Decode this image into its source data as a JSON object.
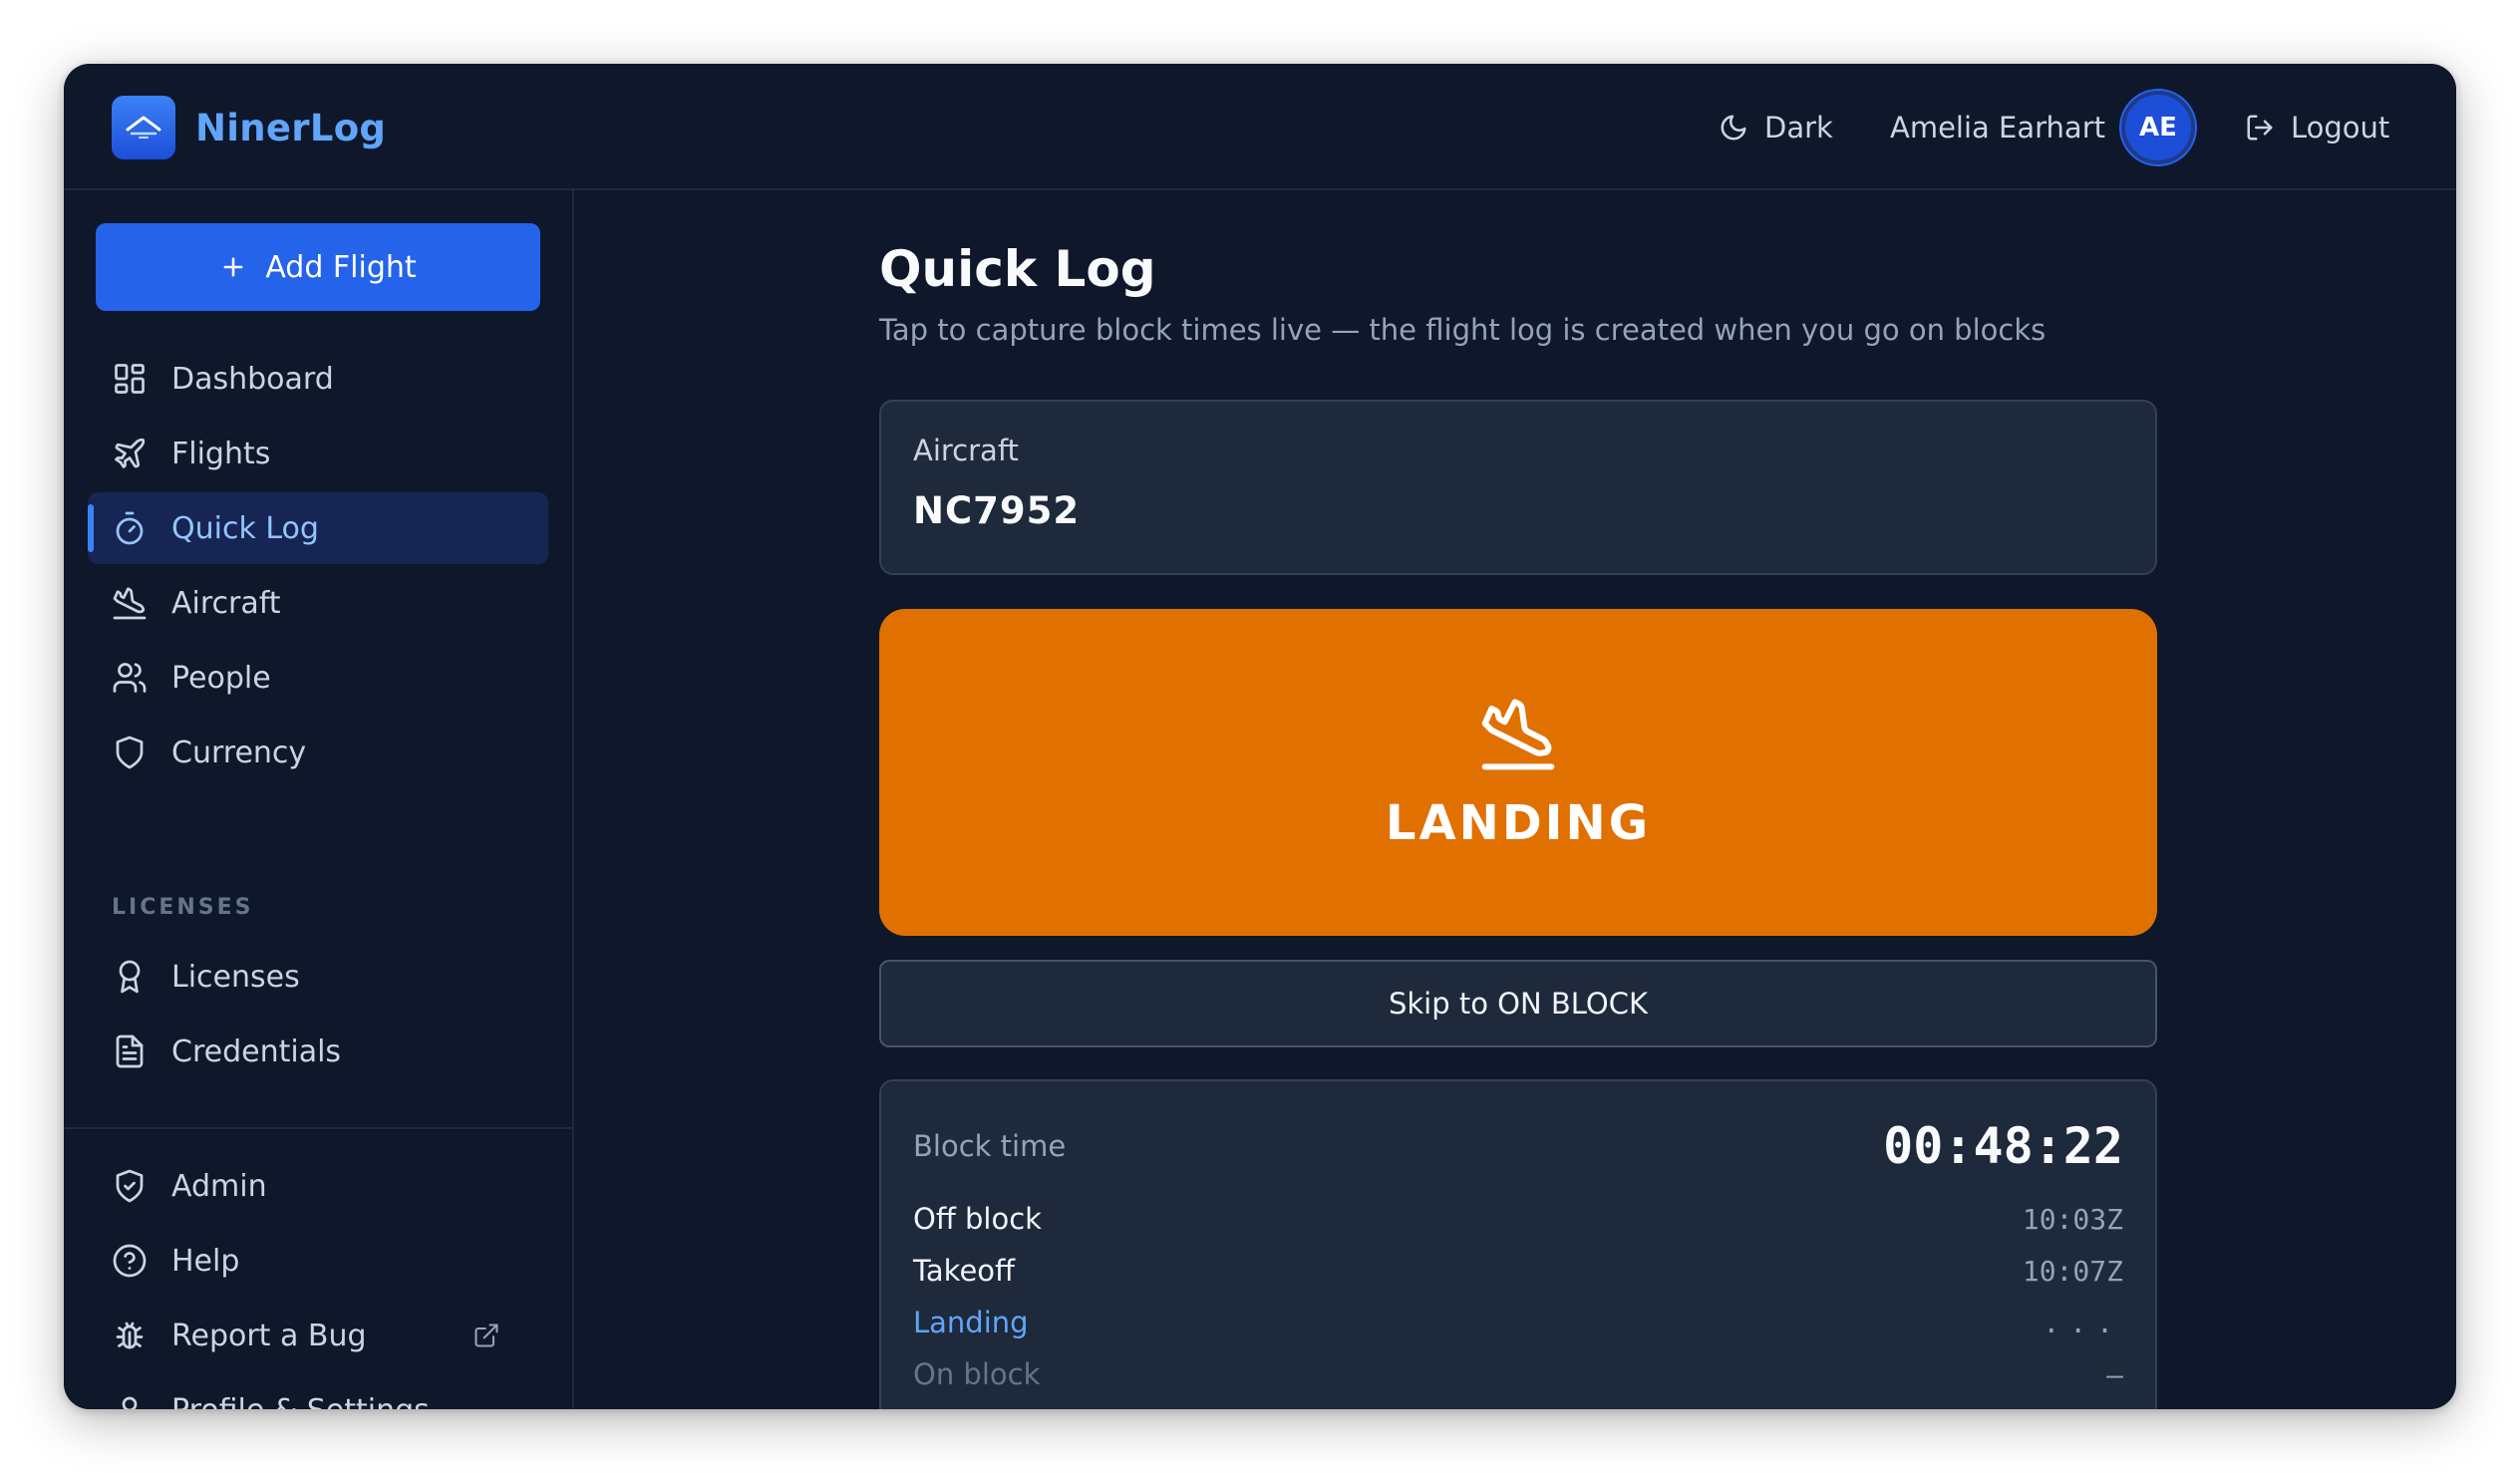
{
  "app": {
    "name": "NinerLog"
  },
  "header": {
    "theme_label": "Dark",
    "user_name": "Amelia Earhart",
    "user_initials": "AE",
    "logout_label": "Logout"
  },
  "sidebar": {
    "add_flight_label": "Add Flight",
    "items": [
      {
        "label": "Dashboard",
        "icon": "dashboard-icon"
      },
      {
        "label": "Flights",
        "icon": "plane-icon"
      },
      {
        "label": "Quick Log",
        "icon": "stopwatch-icon",
        "active": true
      },
      {
        "label": "Aircraft",
        "icon": "plane-landing-icon"
      },
      {
        "label": "People",
        "icon": "users-icon"
      },
      {
        "label": "Currency",
        "icon": "shield-icon"
      }
    ],
    "licenses_section": "LICENSES",
    "license_items": [
      {
        "label": "Licenses",
        "icon": "award-icon"
      },
      {
        "label": "Credentials",
        "icon": "document-icon"
      }
    ],
    "bottom_items": [
      {
        "label": "Admin",
        "icon": "shield-check-icon"
      },
      {
        "label": "Help",
        "icon": "help-circle-icon"
      },
      {
        "label": "Report a Bug",
        "icon": "bug-icon",
        "external": true
      },
      {
        "label": "Profile & Settings",
        "icon": "user-icon"
      }
    ]
  },
  "main": {
    "title": "Quick Log",
    "subtitle": "Tap to capture block times live — the flight log is created when you go on blocks",
    "aircraft": {
      "label": "Aircraft",
      "registration": "NC7952"
    },
    "action_button": {
      "label": "LANDING",
      "icon": "plane-landing-icon",
      "color": "#e07000"
    },
    "skip_button_label": "Skip to ON BLOCK",
    "block": {
      "label": "Block time",
      "timer": "00:48:22",
      "rows": [
        {
          "label": "Off block",
          "value": "10:03Z",
          "state": "done"
        },
        {
          "label": "Takeoff",
          "value": "10:07Z",
          "state": "done"
        },
        {
          "label": "Landing",
          "value": "...",
          "state": "current"
        },
        {
          "label": "On block",
          "value": "—",
          "state": "pending"
        }
      ]
    }
  },
  "colors": {
    "background": "#0f172a",
    "card": "#1e293b",
    "accent": "#2563eb",
    "active_text": "#60a5fa",
    "landing": "#e07000"
  }
}
